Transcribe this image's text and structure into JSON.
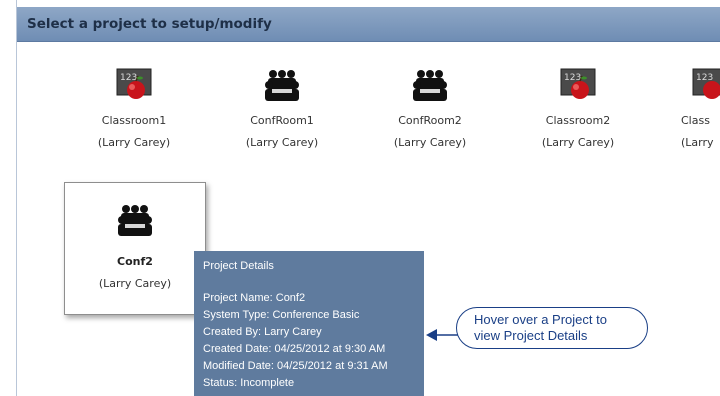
{
  "header": {
    "title": "Select a project to setup/modify"
  },
  "projects": [
    {
      "name": "Classroom1",
      "owner": "(Larry Carey)",
      "icon": "classroom-apple-icon"
    },
    {
      "name": "ConfRoom1",
      "owner": "(Larry Carey)",
      "icon": "conference-people-icon"
    },
    {
      "name": "ConfRoom2",
      "owner": "(Larry Carey)",
      "icon": "conference-people-icon"
    },
    {
      "name": "Classroom2",
      "owner": "(Larry Carey)",
      "icon": "classroom-apple-icon"
    },
    {
      "name": "Class",
      "owner": "(Larry",
      "icon": "classroom-apple-icon"
    },
    {
      "name": "Conf2",
      "owner": "(Larry Carey)",
      "icon": "conference-people-icon"
    }
  ],
  "tooltip": {
    "title": "Project Details",
    "lines": [
      "Project Name: Conf2",
      "System Type: Conference Basic",
      "Created By: Larry Carey",
      "Created Date: 04/25/2012 at 9:30 AM",
      "Modified Date: 04/25/2012 at 9:31 AM",
      "Status: Incomplete"
    ]
  },
  "callout": {
    "line1": "Hover over a Project to",
    "line2": "view Project Details"
  },
  "colors": {
    "header": "#7c97bb",
    "header_text": "#1e2f47",
    "tooltip_bg": "#5f7b9e",
    "callout": "#1a3f86"
  }
}
